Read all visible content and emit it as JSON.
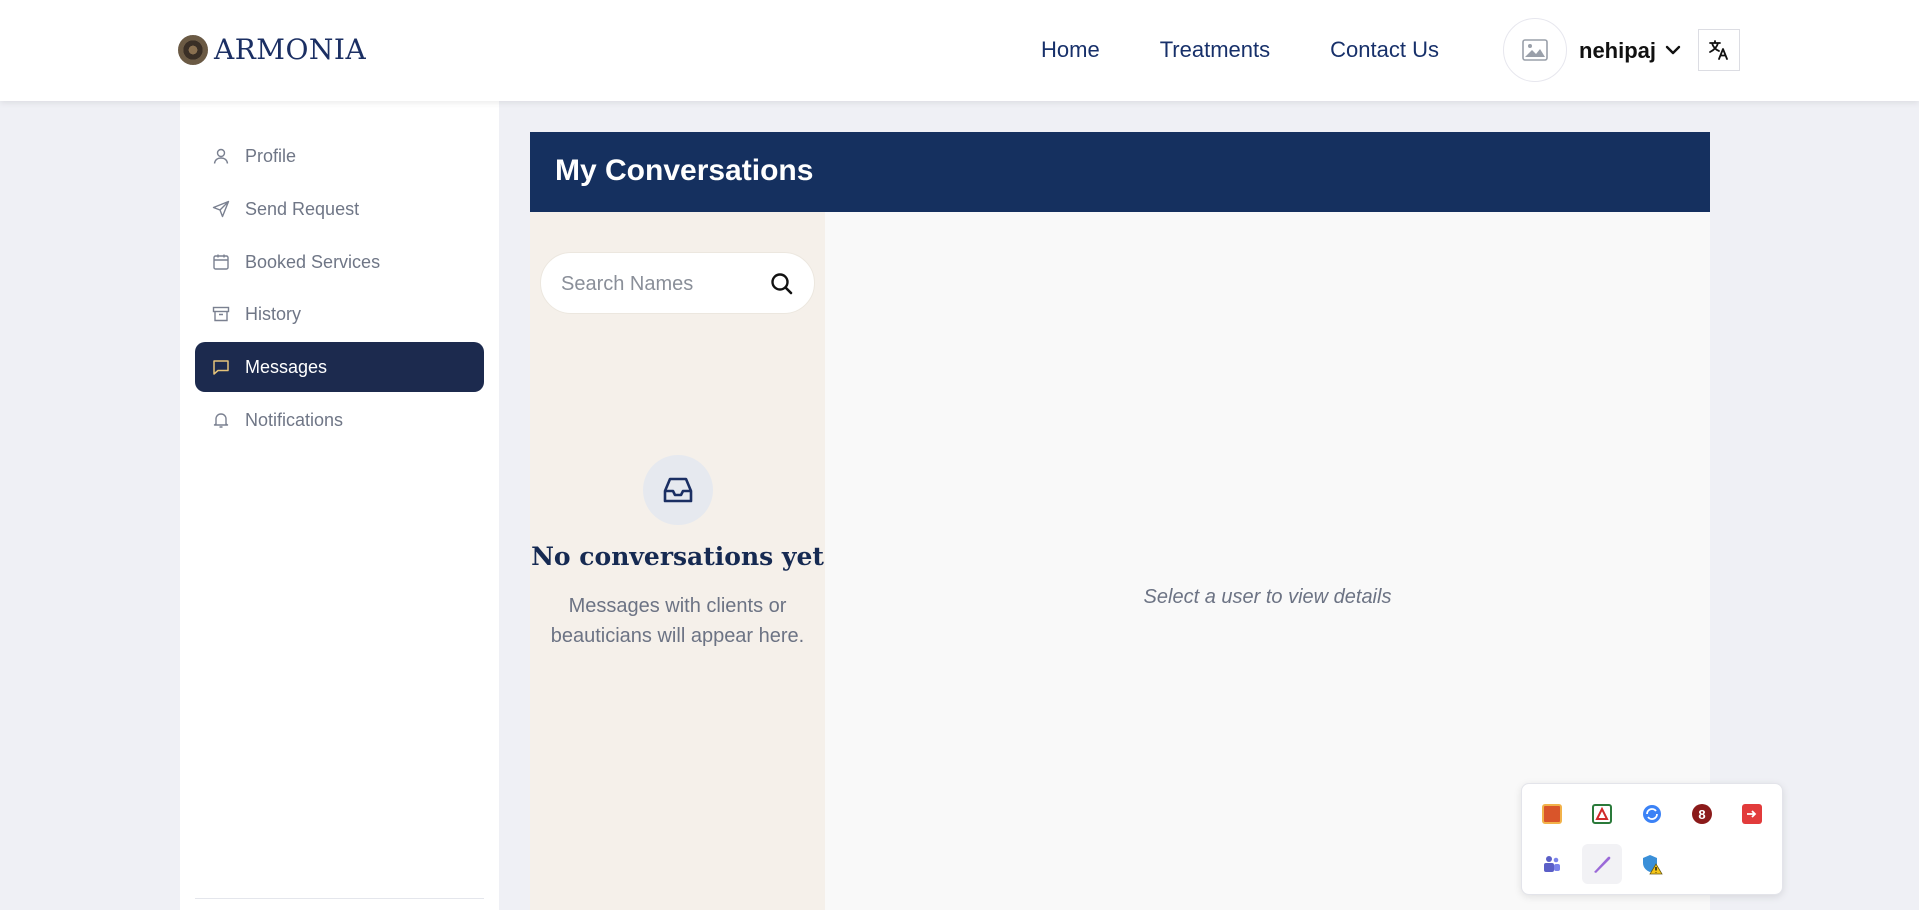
{
  "brand": {
    "name": "ARMONIA"
  },
  "nav": {
    "links": [
      {
        "label": "Home"
      },
      {
        "label": "Treatments"
      },
      {
        "label": "Contact Us"
      }
    ],
    "user": {
      "name": "nehipaj",
      "avatar_icon": "image-placeholder-icon"
    },
    "translate_icon": "translate-icon"
  },
  "sidebar": {
    "items": [
      {
        "label": "Profile",
        "icon": "user-icon",
        "active": false
      },
      {
        "label": "Send Request",
        "icon": "send-icon",
        "active": false
      },
      {
        "label": "Booked Services",
        "icon": "calendar-icon",
        "active": false
      },
      {
        "label": "History",
        "icon": "archive-icon",
        "active": false
      },
      {
        "label": "Messages",
        "icon": "message-icon",
        "active": true
      },
      {
        "label": "Notifications",
        "icon": "bell-icon",
        "active": false
      }
    ]
  },
  "conversations": {
    "title": "My Conversations",
    "search": {
      "placeholder": "Search Names",
      "value": ""
    },
    "empty": {
      "icon": "inbox-icon",
      "title": "No conversations yet",
      "description": "Messages with clients or beauticians will appear here."
    },
    "detail_placeholder": "Select a user to view details"
  },
  "tray": {
    "icons": [
      "app-tray-icon-1",
      "app-tray-icon-2",
      "sync-icon",
      "app-tray-icon-4",
      "app-tray-icon-5",
      "teams-icon",
      "pen-icon",
      "security-warning-icon"
    ]
  },
  "colors": {
    "primary_navy": "#15305f",
    "active_sidebar": "#1c2a4e",
    "list_bg": "#f5f0ea",
    "page_bg": "#eff0f5"
  }
}
